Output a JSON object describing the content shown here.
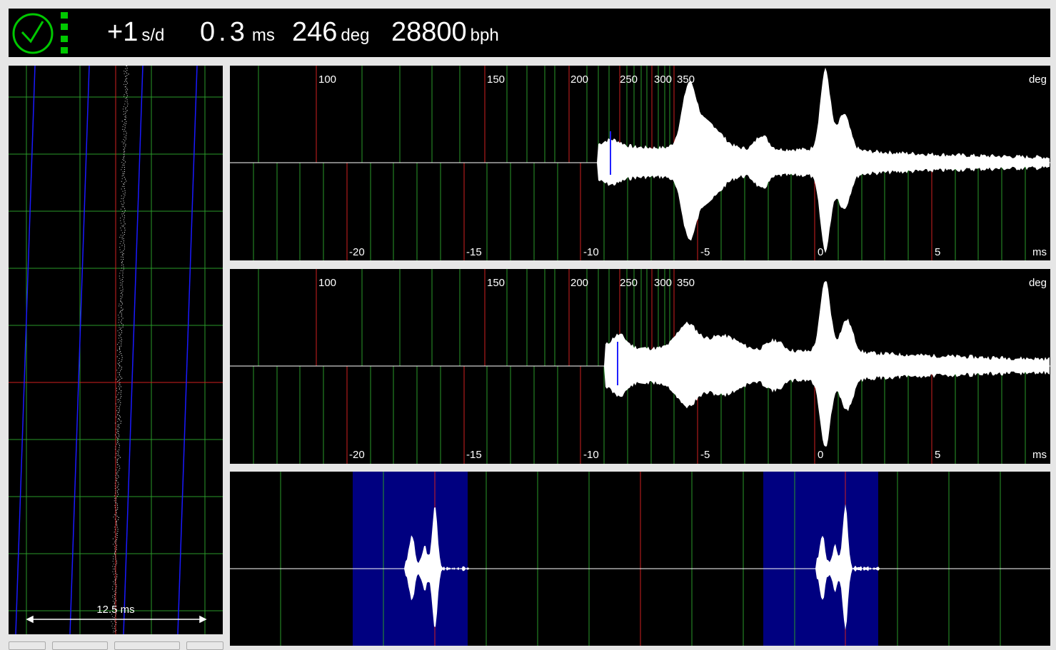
{
  "header": {
    "status_icon": "clock-icon",
    "signal_icon": "signal-bars-icon",
    "accent_color": "#00c800",
    "rate": {
      "value": "+1",
      "unit": "s/d"
    },
    "beat_error": {
      "value": "0.3",
      "unit": "ms"
    },
    "amplitude": {
      "value": "246",
      "unit": "deg"
    },
    "bph": {
      "value": "28800",
      "unit": "bph"
    }
  },
  "paper_strip": {
    "scale_label": "12.5 ms"
  },
  "scope": {
    "deg_ticks": [
      "100",
      "150",
      "200",
      "250",
      "300",
      "350"
    ],
    "deg_unit": "deg",
    "ms_ticks": [
      "-20",
      "-15",
      "-10",
      "-5",
      "0",
      "5"
    ],
    "ms_unit": "ms"
  }
}
